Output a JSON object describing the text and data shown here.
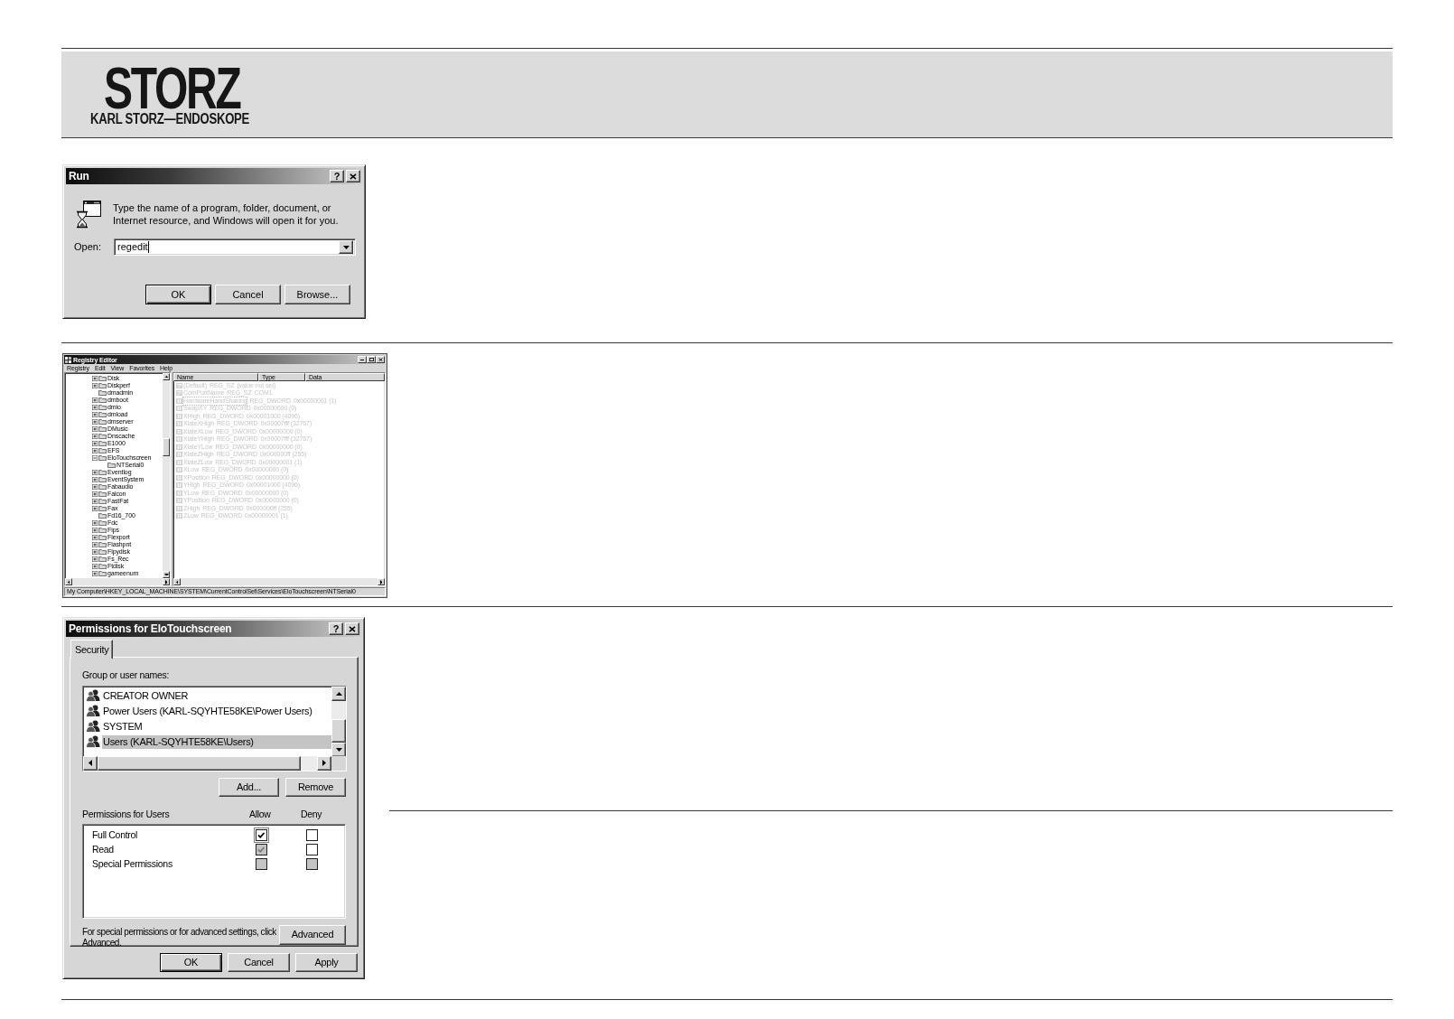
{
  "header": {
    "logo_wordmark": "STORZ",
    "logo_tagline": "KARL STORZ—ENDOSKOPE"
  },
  "run_dialog": {
    "title": "Run",
    "help_button": "?",
    "prompt": "Type the name of a program, folder, document, or Internet resource, and Windows will open it for you.",
    "open_label": "Open:",
    "open_value": "regedit",
    "buttons": [
      {
        "label": "OK",
        "default": true
      },
      {
        "label": "Cancel",
        "default": false
      },
      {
        "label": "Browse...",
        "default": false
      }
    ]
  },
  "registry_editor": {
    "title": "Registry Editor",
    "menu": [
      "Registry",
      "Edit",
      "View",
      "Favorites",
      "Help"
    ],
    "tree": [
      {
        "label": "Disk",
        "has_children": true,
        "expanded": false
      },
      {
        "label": "Diskperf",
        "has_children": true,
        "expanded": false
      },
      {
        "label": "dmadmin",
        "has_children": false
      },
      {
        "label": "dmboot",
        "has_children": true,
        "expanded": false
      },
      {
        "label": "dmio",
        "has_children": true,
        "expanded": false
      },
      {
        "label": "dmload",
        "has_children": true,
        "expanded": false
      },
      {
        "label": "dmserver",
        "has_children": true,
        "expanded": false
      },
      {
        "label": "DMusic",
        "has_children": true,
        "expanded": false
      },
      {
        "label": "Dnscache",
        "has_children": true,
        "expanded": false
      },
      {
        "label": "E1000",
        "has_children": true,
        "expanded": false
      },
      {
        "label": "EFS",
        "has_children": true,
        "expanded": false
      },
      {
        "label": "EloTouchscreen",
        "has_children": true,
        "expanded": true,
        "children": [
          {
            "label": "NTSerial0",
            "has_children": false
          }
        ]
      },
      {
        "label": "Eventlog",
        "has_children": true,
        "expanded": false
      },
      {
        "label": "EventSystem",
        "has_children": true,
        "expanded": false
      },
      {
        "label": "Fabaudio",
        "has_children": true,
        "expanded": false
      },
      {
        "label": "Falcon",
        "has_children": true,
        "expanded": false
      },
      {
        "label": "FastFat",
        "has_children": true,
        "expanded": false
      },
      {
        "label": "Fax",
        "has_children": true,
        "expanded": false
      },
      {
        "label": "Fd16_700",
        "has_children": false
      },
      {
        "label": "Fdc",
        "has_children": true,
        "expanded": false
      },
      {
        "label": "Fips",
        "has_children": true,
        "expanded": false
      },
      {
        "label": "Flexport",
        "has_children": true,
        "expanded": false
      },
      {
        "label": "Flashpnt",
        "has_children": true,
        "expanded": false
      },
      {
        "label": "Flpydisk",
        "has_children": true,
        "expanded": false
      },
      {
        "label": "Fs_Rec",
        "has_children": true,
        "expanded": false
      },
      {
        "label": "Ftdisk",
        "has_children": true,
        "expanded": false
      },
      {
        "label": "gameenum",
        "has_children": true,
        "expanded": false
      }
    ],
    "columns": [
      "Name",
      "Type",
      "Data"
    ],
    "values": [
      {
        "kind": "string",
        "name": "(Default)",
        "type": "REG_SZ",
        "data": "(value not set)",
        "focused": false
      },
      {
        "kind": "string",
        "name": "ComPortName",
        "type": "REG_SZ",
        "data": "COM1",
        "focused": false
      },
      {
        "kind": "dword",
        "name": "HardwareHandShaking",
        "type": "REG_DWORD",
        "data": "0x00000001 (1)",
        "focused": true
      },
      {
        "kind": "dword",
        "name": "SwapXY",
        "type": "REG_DWORD",
        "data": "0x00000000 (0)",
        "focused": false
      },
      {
        "kind": "dword",
        "name": "XHigh",
        "type": "REG_DWORD",
        "data": "0x00001000 (4096)",
        "focused": false
      },
      {
        "kind": "dword",
        "name": "XlateXHigh",
        "type": "REG_DWORD",
        "data": "0x00007fff (32767)",
        "focused": false
      },
      {
        "kind": "dword",
        "name": "XlateXLow",
        "type": "REG_DWORD",
        "data": "0x00000000 (0)",
        "focused": false
      },
      {
        "kind": "dword",
        "name": "XlateYHigh",
        "type": "REG_DWORD",
        "data": "0x00007fff (32767)",
        "focused": false
      },
      {
        "kind": "dword",
        "name": "XlateYLow",
        "type": "REG_DWORD",
        "data": "0x00000000 (0)",
        "focused": false
      },
      {
        "kind": "dword",
        "name": "XlateZHigh",
        "type": "REG_DWORD",
        "data": "0x000000ff (255)",
        "focused": false
      },
      {
        "kind": "dword",
        "name": "XlateZLow",
        "type": "REG_DWORD",
        "data": "0x00000001 (1)",
        "focused": false
      },
      {
        "kind": "dword",
        "name": "XLow",
        "type": "REG_DWORD",
        "data": "0x00000000 (0)",
        "focused": false
      },
      {
        "kind": "dword",
        "name": "XPosition",
        "type": "REG_DWORD",
        "data": "0x00000000 (0)",
        "focused": false
      },
      {
        "kind": "dword",
        "name": "YHigh",
        "type": "REG_DWORD",
        "data": "0x00001000 (4096)",
        "focused": false
      },
      {
        "kind": "dword",
        "name": "YLow",
        "type": "REG_DWORD",
        "data": "0x00000000 (0)",
        "focused": false
      },
      {
        "kind": "dword",
        "name": "YPosition",
        "type": "REG_DWORD",
        "data": "0x00000000 (0)",
        "focused": false
      },
      {
        "kind": "dword",
        "name": "ZHigh",
        "type": "REG_DWORD",
        "data": "0x000000ff (255)",
        "focused": false
      },
      {
        "kind": "dword",
        "name": "ZLow",
        "type": "REG_DWORD",
        "data": "0x00000001 (1)",
        "focused": false
      }
    ],
    "status_bar": "My Computer\\HKEY_LOCAL_MACHINE\\SYSTEM\\CurrentControlSet\\Services\\EloTouchscreen\\NTSerial0"
  },
  "permissions_dialog": {
    "title": "Permissions for EloTouchscreen",
    "help_button": "?",
    "tabs": [
      {
        "label": "Security",
        "selected": true
      }
    ],
    "group_label": "Group or user names:",
    "users": [
      {
        "name": "CREATOR OWNER",
        "selected": false
      },
      {
        "name": "Power Users (KARL-SQYHTE58KE\\Power Users)",
        "selected": false
      },
      {
        "name": "SYSTEM",
        "selected": false
      },
      {
        "name": "Users (KARL-SQYHTE58KE\\Users)",
        "selected": true
      }
    ],
    "user_buttons": [
      "Add...",
      "Remove"
    ],
    "permissions_label": "Permissions for Users",
    "columns": [
      "Allow",
      "Deny"
    ],
    "permissions": [
      {
        "name": "Full Control",
        "allow": {
          "checked": true,
          "disabled": false,
          "focused": true
        },
        "deny": {
          "checked": false,
          "disabled": false,
          "focused": false
        }
      },
      {
        "name": "Read",
        "allow": {
          "checked": true,
          "disabled": true,
          "focused": false
        },
        "deny": {
          "checked": false,
          "disabled": false,
          "focused": false
        }
      },
      {
        "name": "Special Permissions",
        "allow": {
          "checked": false,
          "disabled": true,
          "focused": false
        },
        "deny": {
          "checked": false,
          "disabled": true,
          "focused": false
        }
      }
    ],
    "advanced_note": "For special permissions or for advanced settings, click Advanced.",
    "advanced_button": "Advanced",
    "buttons": [
      {
        "label": "OK",
        "default": true
      },
      {
        "label": "Cancel",
        "default": false
      },
      {
        "label": "Apply",
        "default": false
      }
    ]
  }
}
